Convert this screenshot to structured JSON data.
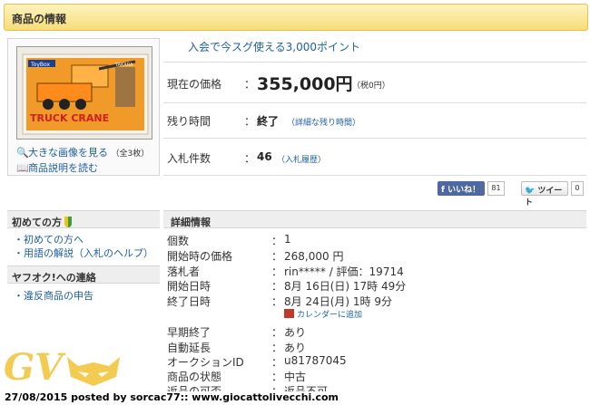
{
  "header": {
    "title": "商品の情報"
  },
  "gallery": {
    "thumb_brand": "ToyBox",
    "thumb_title": "TRUCK CRANE",
    "thumb_maker": "TAKARA",
    "enlarge_label": "大きな画像を見る",
    "enlarge_count": "（全3枚）",
    "description_label": "商品説明を読む"
  },
  "auction": {
    "promo": "入会で今スグ使える3,000ポイント",
    "price_label": "現在の価格",
    "price_value": "355,000円",
    "price_tax": "（税0円）",
    "time_label": "残り時間",
    "time_value": "終了",
    "time_link": "（詳細な残り時間）",
    "bids_label": "入札件数",
    "bids_value": "46",
    "bids_link": "（入札履歴）",
    "colon": "："
  },
  "social": {
    "like_label": "いいね！",
    "like_count": "81",
    "tweet_label": "ツイート",
    "tweet_count": "0"
  },
  "sidebar": {
    "beginners_heading": "初めての方",
    "beginners_items": [
      "・初めての方へ",
      "・用語の解説（入札のヘルプ）"
    ],
    "contact_heading": "ヤフオク!への連絡",
    "contact_items": [
      "・違反商品の申告"
    ]
  },
  "details": {
    "heading": "詳細情報",
    "rows": [
      {
        "label": "個数",
        "value": "1"
      },
      {
        "label": "開始時の価格",
        "value": "268,000 円"
      },
      {
        "label": "落札者",
        "value": "rin***** / 評価：19714"
      },
      {
        "label": "開始日時",
        "value": "8月 16日(日) 17時 49分"
      },
      {
        "label": "終了日時",
        "value": "8月 24日(月) 1時 9分"
      },
      {
        "label": "早期終了",
        "value": "あり"
      },
      {
        "label": "自動延長",
        "value": "あり"
      },
      {
        "label": "オークションID",
        "value": "u81787045"
      },
      {
        "label": "商品の状態",
        "value": "中古"
      },
      {
        "label": "返品の可否",
        "value": "返品不可"
      }
    ],
    "calendar_link": "カレンダーに追加"
  },
  "watermark": {
    "logo": "GV",
    "caption": "27/08/2015 posted by sorcac77:: www.giocattolivecchi.com"
  },
  "colors": {
    "header": "#f6dd79",
    "link": "#1d5ea8",
    "facebook": "#4e69a2",
    "watermark": "#f1c232"
  }
}
